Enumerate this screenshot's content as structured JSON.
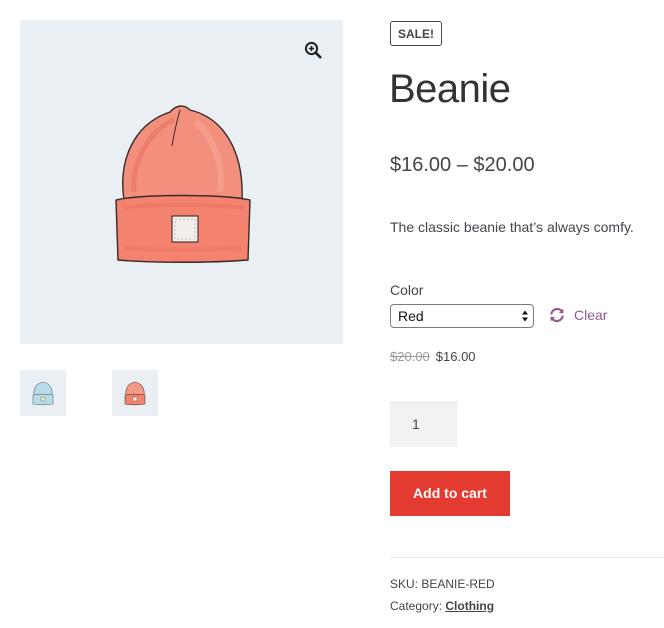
{
  "product": {
    "badge": "SALE!",
    "title": "Beanie",
    "price_range": "$16.00 – $20.00",
    "short_description": "The classic beanie that’s always comfy.",
    "attribute_label": "Color",
    "selected_color": "Red",
    "clear_label": "Clear",
    "regular_price": "$20.00",
    "sale_price": "$16.00",
    "quantity": "1",
    "add_to_cart_label": "Add to cart",
    "sku_label": "SKU:",
    "sku_value": "BEANIE-RED",
    "category_label": "Category:",
    "category_value": "Clothing"
  },
  "gallery": {
    "zoom_icon": "magnifier-plus-icon",
    "thumbnails": [
      {
        "name": "beanie-blue",
        "color": "#b9dbe9"
      },
      {
        "name": "beanie-red",
        "color": "#f39a86"
      }
    ]
  },
  "colors": {
    "accent": "#96588a",
    "cart_button": "#e33a31",
    "gallery_bg": "#eaeff4",
    "hat_red": "#f3826f"
  }
}
